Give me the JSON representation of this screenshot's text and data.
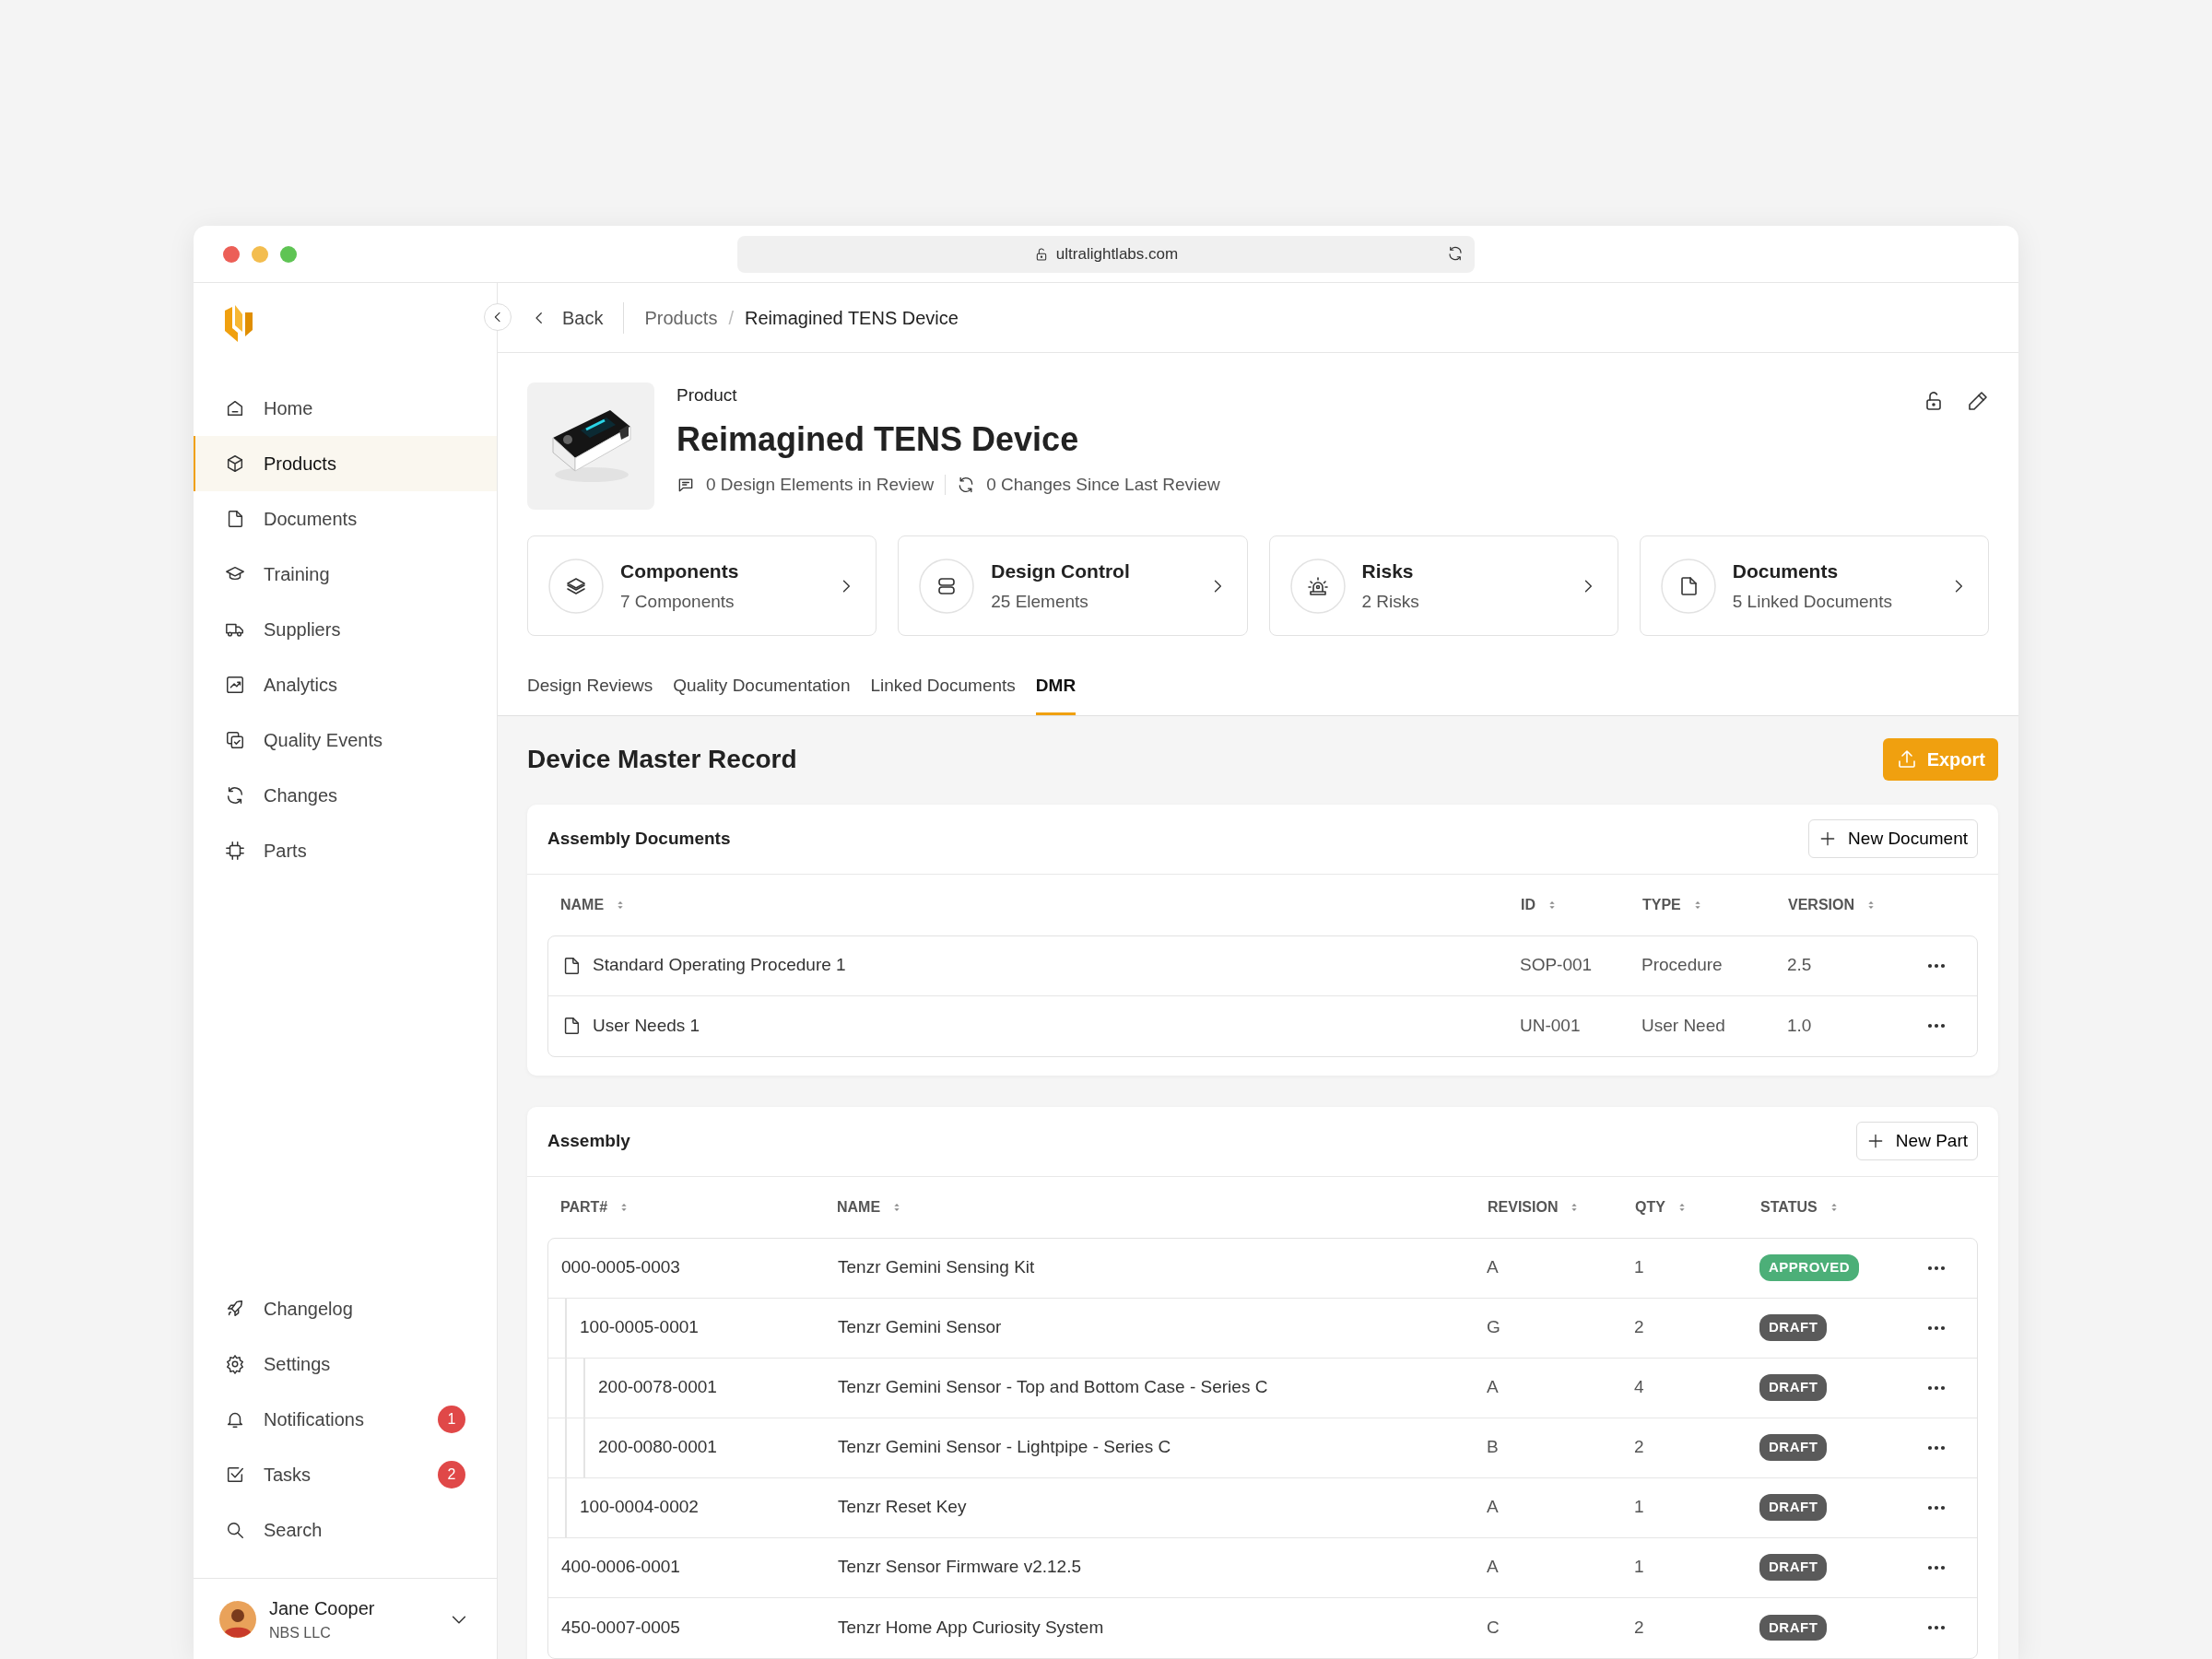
{
  "browser": {
    "url": "ultralightlabs.com"
  },
  "sidebar": {
    "items": [
      {
        "label": "Home",
        "selected": false
      },
      {
        "label": "Products",
        "selected": true
      },
      {
        "label": "Documents",
        "selected": false
      },
      {
        "label": "Training",
        "selected": false
      },
      {
        "label": "Suppliers",
        "selected": false
      },
      {
        "label": "Analytics",
        "selected": false
      },
      {
        "label": "Quality Events",
        "selected": false
      },
      {
        "label": "Changes",
        "selected": false
      },
      {
        "label": "Parts",
        "selected": false
      }
    ],
    "footer_items": [
      {
        "label": "Changelog"
      },
      {
        "label": "Settings"
      },
      {
        "label": "Notifications",
        "badge": "1"
      },
      {
        "label": "Tasks",
        "badge": "2"
      },
      {
        "label": "Search"
      }
    ],
    "user": {
      "name": "Jane Cooper",
      "org": "NBS LLC"
    }
  },
  "breadcrumb": {
    "back": "Back",
    "separator": "/",
    "items": [
      "Products",
      "Reimagined TENS Device"
    ]
  },
  "product": {
    "label": "Product",
    "title": "Reimagined TENS Device",
    "stats": [
      "0 Design Elements in Review",
      "0 Changes Since Last Review"
    ],
    "image": {
      "kind": "picture"
    }
  },
  "summary_cards": [
    {
      "title": "Components",
      "subtitle": "7 Components"
    },
    {
      "title": "Design Control",
      "subtitle": "25 Elements"
    },
    {
      "title": "Risks",
      "subtitle": "2 Risks"
    },
    {
      "title": "Documents",
      "subtitle": "5 Linked Documents"
    }
  ],
  "tabs": [
    {
      "label": "Design Reviews",
      "selected": false
    },
    {
      "label": "Quality Documentation",
      "selected": false
    },
    {
      "label": "Linked Documents",
      "selected": false
    },
    {
      "label": "DMR",
      "selected": true
    }
  ],
  "section": {
    "title": "Device Master Record",
    "export": "Export"
  },
  "assembly_documents": {
    "title": "Assembly Documents",
    "new_button": "New Document",
    "columns": [
      "NAME",
      "ID",
      "TYPE",
      "VERSION"
    ],
    "rows": [
      {
        "name": "Standard Operating Procedure 1",
        "id": "SOP-001",
        "type": "Procedure",
        "version": "2.5"
      },
      {
        "name": "User Needs 1",
        "id": "UN-001",
        "type": "User Need",
        "version": "1.0"
      }
    ]
  },
  "assembly": {
    "title": "Assembly",
    "new_button": "New Part",
    "columns": [
      "PART#",
      "NAME",
      "REVISION",
      "QTY",
      "STATUS"
    ],
    "rows": [
      {
        "part": "000-0005-0003",
        "name": "Tenzr Gemini Sensing Kit",
        "revision": "A",
        "qty": "1",
        "status": "APPROVED",
        "color": "#4caf78",
        "children": [
          {
            "part": "100-0005-0001",
            "name": "Tenzr Gemini Sensor",
            "revision": "G",
            "qty": "2",
            "status": "DRAFT",
            "color": "#5a5a5a",
            "children": [
              {
                "part": "200-0078-0001",
                "name": "Tenzr Gemini Sensor - Top and Bottom Case - Series C",
                "revision": "A",
                "qty": "4",
                "status": "DRAFT",
                "color": "#5a5a5a"
              },
              {
                "part": "200-0080-0001",
                "name": "Tenzr Gemini Sensor - Lightpipe - Series C",
                "revision": "B",
                "qty": "2",
                "status": "DRAFT",
                "color": "#5a5a5a"
              }
            ]
          },
          {
            "part": "100-0004-0002",
            "name": "Tenzr Reset Key",
            "revision": "A",
            "qty": "1",
            "status": "DRAFT",
            "color": "#5a5a5a"
          }
        ]
      },
      {
        "part": "400-0006-0001",
        "name": "Tenzr Sensor Firmware v2.12.5",
        "revision": "A",
        "qty": "1",
        "status": "DRAFT",
        "color": "#5a5a5a"
      },
      {
        "part": "450-0007-0005",
        "name": "Tenzr Home App Curiosity System",
        "revision": "C",
        "qty": "2",
        "status": "DRAFT",
        "color": "#5a5a5a"
      }
    ]
  }
}
